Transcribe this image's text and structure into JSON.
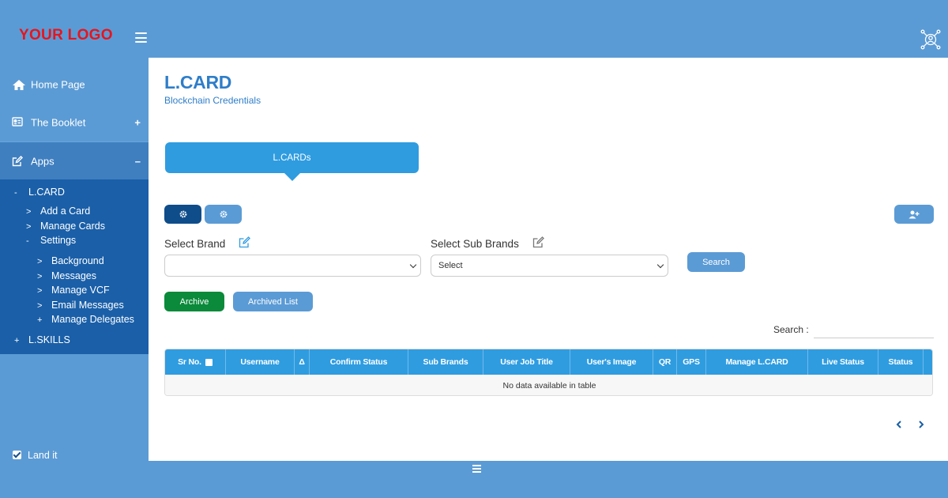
{
  "header": {
    "logo_text": "YOUR LOGO",
    "menu_icon": "hamburger-icon",
    "user_icon": "user-network-icon"
  },
  "sidebar": {
    "items": [
      {
        "label": "Home Page",
        "icon": "home-icon",
        "sign": ""
      },
      {
        "label": "The Booklet",
        "icon": "id-card-icon",
        "sign": "+"
      },
      {
        "label": "Apps",
        "icon": "edit-icon",
        "sign": "–"
      }
    ],
    "submenu": {
      "lcard": {
        "mark": "-",
        "label": "L.CARD"
      },
      "lcard_children": [
        {
          "mark": ">",
          "label": "Add a Card"
        },
        {
          "mark": ">",
          "label": "Manage Cards"
        },
        {
          "mark": "-",
          "label": "Settings"
        }
      ],
      "settings_children": [
        {
          "mark": ">",
          "label": "Background"
        },
        {
          "mark": ">",
          "label": "Messages"
        },
        {
          "mark": ">",
          "label": "Manage VCF"
        },
        {
          "mark": ">",
          "label": "Email Messages"
        },
        {
          "mark": "+",
          "label": "Manage Delegates"
        }
      ],
      "lskills": {
        "mark": "+",
        "label": "L.SKILLS"
      }
    },
    "footer": {
      "label": "Land it",
      "checked": true
    }
  },
  "main": {
    "title": "L.CARD",
    "subtitle": "Blockchain Credentials",
    "tab_label": "L.CARDs",
    "filters": {
      "brand_label": "Select Brand",
      "brand_value": "",
      "sub_brand_label": "Select Sub Brands",
      "sub_brand_value": "Select"
    },
    "buttons": {
      "search": "Search",
      "archive": "Archive",
      "archived_list": "Archived List"
    },
    "table_search_label": "Search :",
    "table": {
      "columns": [
        "Sr No.",
        "Username",
        "Δ",
        "Confirm Status",
        "Sub Brands",
        "User Job Title",
        "User's Image",
        "QR",
        "GPS",
        "Manage L.CARD",
        "Live Status",
        "Status"
      ],
      "empty_message": "No data available in table"
    }
  },
  "colors": {
    "brand_blue": "#5b9bd5",
    "sidebar_submenu": "#1a5fa8",
    "table_header": "#2f9ce0",
    "logo_red": "#e8141c",
    "archive_green": "#0a8a3a",
    "dark_button": "#0f4c8a"
  }
}
